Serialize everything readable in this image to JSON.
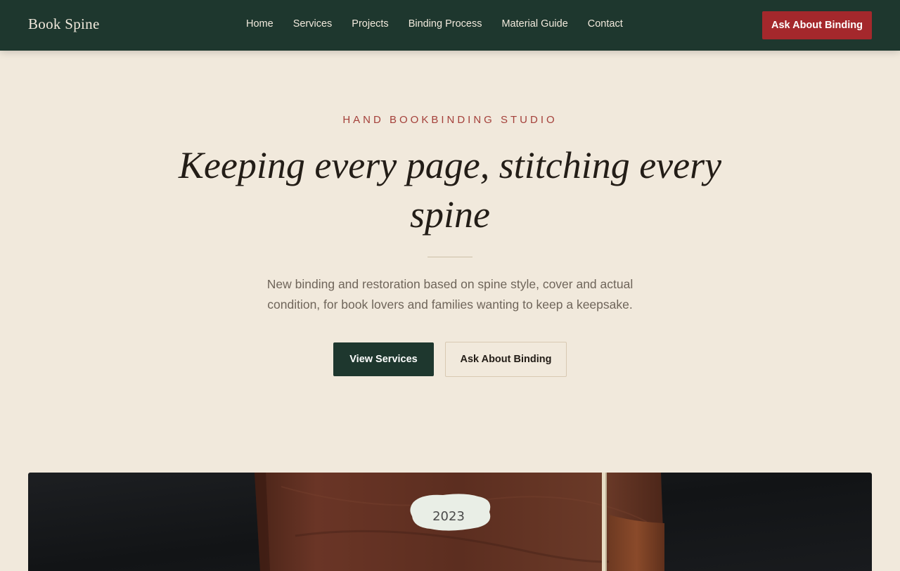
{
  "header": {
    "brand": "Book Spine",
    "nav": [
      "Home",
      "Services",
      "Projects",
      "Binding Process",
      "Material Guide",
      "Contact"
    ],
    "cta_label": "Ask About Binding"
  },
  "hero": {
    "eyebrow": "HAND BOOKBINDING STUDIO",
    "title": "Keeping every page, stitching every spine",
    "description": "New binding and restoration based on spine style, cover and actual condition, for book lovers and families wanting to keep a keepsake.",
    "primary_button": "View Services",
    "secondary_button": "Ask About Binding",
    "image_label": "2023"
  },
  "colors": {
    "header_bg": "#1e372e",
    "page_bg": "#f1e9dc",
    "accent_red": "#a4282c",
    "eyebrow_red": "#a4403a",
    "primary_button_bg": "#1e372e"
  }
}
